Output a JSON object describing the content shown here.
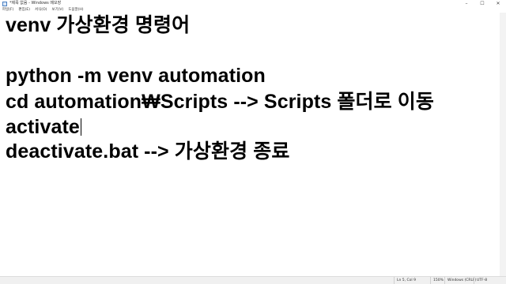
{
  "window": {
    "title": "*제목 없음 - Windows 메모장",
    "controls": {
      "minimize": "–",
      "maximize": "☐",
      "close": "✕"
    }
  },
  "menu": {
    "items": [
      "파일(F)",
      "편집(E)",
      "서식(O)",
      "보기(V)",
      "도움말(H)"
    ]
  },
  "editor": {
    "lines": [
      "venv 가상환경 명령어",
      "",
      "python -m venv automation",
      "cd automation₩Scripts --> Scripts 폴더로 이동",
      "activate",
      "deactivate.bat --> 가상환경 종료"
    ]
  },
  "status": {
    "position": "Ln 5, Col 9",
    "zoom": "150%",
    "line_ending": "Windows (CRLF)",
    "encoding": "UTF-8"
  }
}
